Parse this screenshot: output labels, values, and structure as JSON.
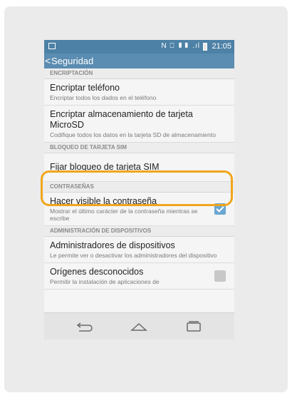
{
  "status_bar": {
    "time": "21:05",
    "icons": "N ⎕ ▮▮ .ıl"
  },
  "app_bar": {
    "back_glyph": "<",
    "title": "Seguridad"
  },
  "sections": [
    {
      "header": "ENCRIPTACIÓN"
    },
    {
      "header": "BLOQUEO DE TARJETA SIM"
    },
    {
      "header": "CONTRASEÑAS"
    },
    {
      "header": "ADMINISTRACIÓN DE DISPOSITIVOS"
    }
  ],
  "items": [
    {
      "title": "Encriptar teléfono",
      "subtitle": "Encriptar todos los dados en el teléfono"
    },
    {
      "title": "Encriptar almacenamiento de tarjeta MicroSD",
      "subtitle": "Codifique todos los datos en la tarjeta SD de almacenamiento"
    },
    {
      "title": "Fijar bloqueo de tarjeta SIM",
      "subtitle": ""
    },
    {
      "title": "Hacer visible la contraseña",
      "subtitle": "Mostrar el último carácter de la contraseña mientras se escribe",
      "checked": true
    },
    {
      "title": "Administradores de dispositivos",
      "subtitle": "Le permite ver o desactivar los administradores del dispositivo"
    },
    {
      "title": "Orígenes desconocidos",
      "subtitle": "Permitir la instalación de aplicaciones de",
      "checked": false
    }
  ],
  "nav": {
    "back_icon": "back-arrow-icon",
    "home_icon": "home-icon",
    "recents_icon": "recent-apps-icon"
  },
  "colors": {
    "status_bar": "#4d81a6",
    "app_bar": "#5b8cb1",
    "highlight": "#f0a61c",
    "checkbox_on": "#6aa7d1"
  }
}
